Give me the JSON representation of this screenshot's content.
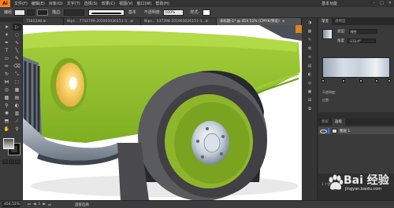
{
  "app": {
    "logo": "Ai"
  },
  "menu": {
    "items": [
      "文件(F)",
      "编辑(E)",
      "对象(O)",
      "文字(T)",
      "选择(S)",
      "效果(C)",
      "视图(V)",
      "窗口(W)",
      "帮助(H)"
    ],
    "workspace": "基本功能"
  },
  "control": {
    "selection_label": "编组",
    "stroke_label": "描边:",
    "brush_label": "基本",
    "opacity_label": "不透明度:",
    "opacity_value": "100%",
    "style_label": "样式:"
  },
  "tabs": [
    {
      "label": "72b1248.ai",
      "active": false
    },
    {
      "label": "Nips... 7742799-201903026151-3...ai",
      "active": false
    },
    {
      "label": "Nips... 537398-201903026151-3...ai",
      "active": false
    },
    {
      "label": "未标题-1* @ 454.51% (CMYK/预览)",
      "active": true
    }
  ],
  "gradient_panel": {
    "tabs": [
      "渐变",
      "透明度"
    ],
    "type_label": "类型:",
    "type_value": "线性",
    "angle_label": "角度",
    "angle_value": "-113.4°",
    "opacity_label": "不透明度:",
    "location_label": "位置:"
  },
  "layers_panel": {
    "tabs": [
      "图层",
      "画板"
    ],
    "layers": [
      {
        "name": "图层 1",
        "color": "#3c77ff"
      }
    ],
    "footer": "1 个图层"
  },
  "status": {
    "zoom": "454.51%",
    "page": "1",
    "text": "直接选择"
  },
  "watermark": {
    "brand": "Bai 经验",
    "url": "jingyan.baidu.com"
  },
  "colors": {
    "car_green": "#8dbb2a",
    "wheel_rim": "#8fb62a",
    "tire": "#5a5a5f",
    "headlight": "#f2c85a"
  }
}
